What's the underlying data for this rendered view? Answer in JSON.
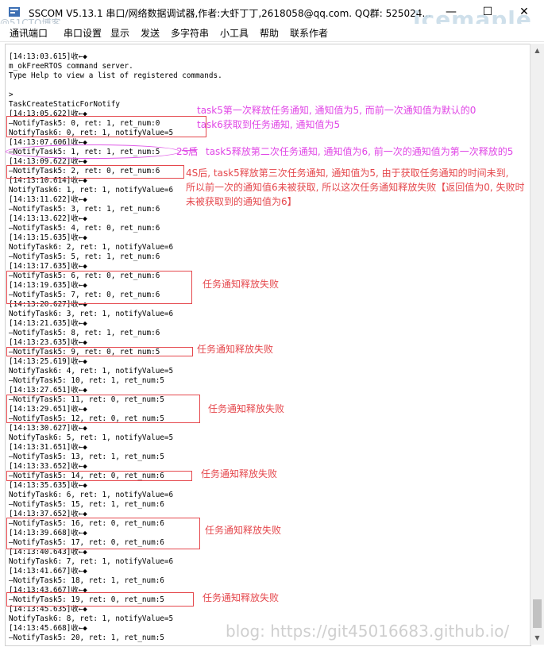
{
  "window": {
    "title": "SSCOM V5.13.1 串口/网络数据调试器,作者:大虾丁丁,2618058@qq.com. QQ群: 525024...",
    "minimize": "—",
    "maximize": "☐",
    "close": "✕",
    "logo_watermark": "icemaple",
    "corner_watermark": "@51CTO博客"
  },
  "menu": {
    "items": [
      "通讯端口",
      "串口设置",
      "显示",
      "发送",
      "多字符串",
      "小工具",
      "帮助",
      "联系作者"
    ]
  },
  "terminal": {
    "lines": [
      "[14:13:03.615]收←◆",
      "m_okFreeRTOS command server.",
      "Type Help to view a list of registered commands.",
      "",
      ">",
      "TaskCreateStaticForNotify",
      "[14:13:05.622]收←◆",
      "—NotifyTask5: 0, ret: 1, ret_num:0",
      "NotifyTask6: 0, ret: 1, notifyValue=5",
      "[14:13:07.606]收←◆",
      "—NotifyTask5: 1, ret: 1, ret_num:5",
      "[14:13:09.622]收←◆",
      "—NotifyTask5: 2, ret: 0, ret_num:6",
      "[14:13:10.614]收←◆",
      "NotifyTask6: 1, ret: 1, notifyValue=6",
      "[14:13:11.622]收←◆",
      "—NotifyTask5: 3, ret: 1, ret_num:6",
      "[14:13:13.622]收←◆",
      "—NotifyTask5: 4, ret: 0, ret_num:6",
      "[14:13:15.635]收←◆",
      "NotifyTask6: 2, ret: 1, notifyValue=6",
      "—NotifyTask5: 5, ret: 1, ret_num:6",
      "[14:13:17.635]收←◆",
      "—NotifyTask5: 6, ret: 0, ret_num:6",
      "[14:13:19.635]收←◆",
      "—NotifyTask5: 7, ret: 0, ret_num:6",
      "[14:13:20.627]收←◆",
      "NotifyTask6: 3, ret: 1, notifyValue=6",
      "[14:13:21.635]收←◆",
      "—NotifyTask5: 8, ret: 1, ret_num:6",
      "[14:13:23.635]收←◆",
      "—NotifyTask5: 9, ret: 0, ret_num:5",
      "[14:13:25.619]收←◆",
      "NotifyTask6: 4, ret: 1, notifyValue=5",
      "—NotifyTask5: 10, ret: 1, ret_num:5",
      "[14:13:27.651]收←◆",
      "—NotifyTask5: 11, ret: 0, ret_num:5",
      "[14:13:29.651]收←◆",
      "—NotifyTask5: 12, ret: 0, ret_num:5",
      "[14:13:30.627]收←◆",
      "NotifyTask6: 5, ret: 1, notifyValue=5",
      "[14:13:31.651]收←◆",
      "—NotifyTask5: 13, ret: 1, ret_num:5",
      "[14:13:33.652]收←◆",
      "—NotifyTask5: 14, ret: 0, ret_num:6",
      "[14:13:35.635]收←◆",
      "NotifyTask6: 6, ret: 1, notifyValue=6",
      "—NotifyTask5: 15, ret: 1, ret_num:6",
      "[14:13:37.652]收←◆",
      "—NotifyTask5: 16, ret: 0, ret_num:6",
      "[14:13:39.668]收←◆",
      "—NotifyTask5: 17, ret: 0, ret_num:6",
      "[14:13:40.643]收←◆",
      "NotifyTask6: 7, ret: 1, notifyValue=6",
      "[14:13:41.667]收←◆",
      "—NotifyTask5: 18, ret: 1, ret_num:6",
      "[14:13:43.667]收←◆",
      "—NotifyTask5: 19, ret: 0, ret_num:5",
      "[14:13:45.635]收←◆",
      "NotifyTask6: 8, ret: 1, notifyValue=5",
      "[14:13:45.668]收←◆",
      "—NotifyTask5: 20, ret: 1, ret_num:5"
    ]
  },
  "annotations": {
    "note1": "task5第一次释放任务通知, 通知值为5, 而前一次通知值为默认的0",
    "note2": "task6获取到任务通知, 通知值为5",
    "note3_prefix": "2S后",
    "note3": "task5释放第二次任务通知, 通知值为6, 前一次的通知值为第一次释放的5",
    "note4_line1": "4S后, task5释放第三次任务通知, 通知值为5, 由于获取任务通知的时间未到,",
    "note4_line2": "所以前一次的通知值6未被获取, 所以这次任务通知释放失败【返回值为0, 失败时",
    "note4_line3": "未被获取到的通知值为6】",
    "fail_label": "任务通知释放失败"
  },
  "colors": {
    "pink": "#e046e6",
    "red": "#e5484d"
  },
  "footer_watermark": "blog: https://git45016683.github.io/"
}
